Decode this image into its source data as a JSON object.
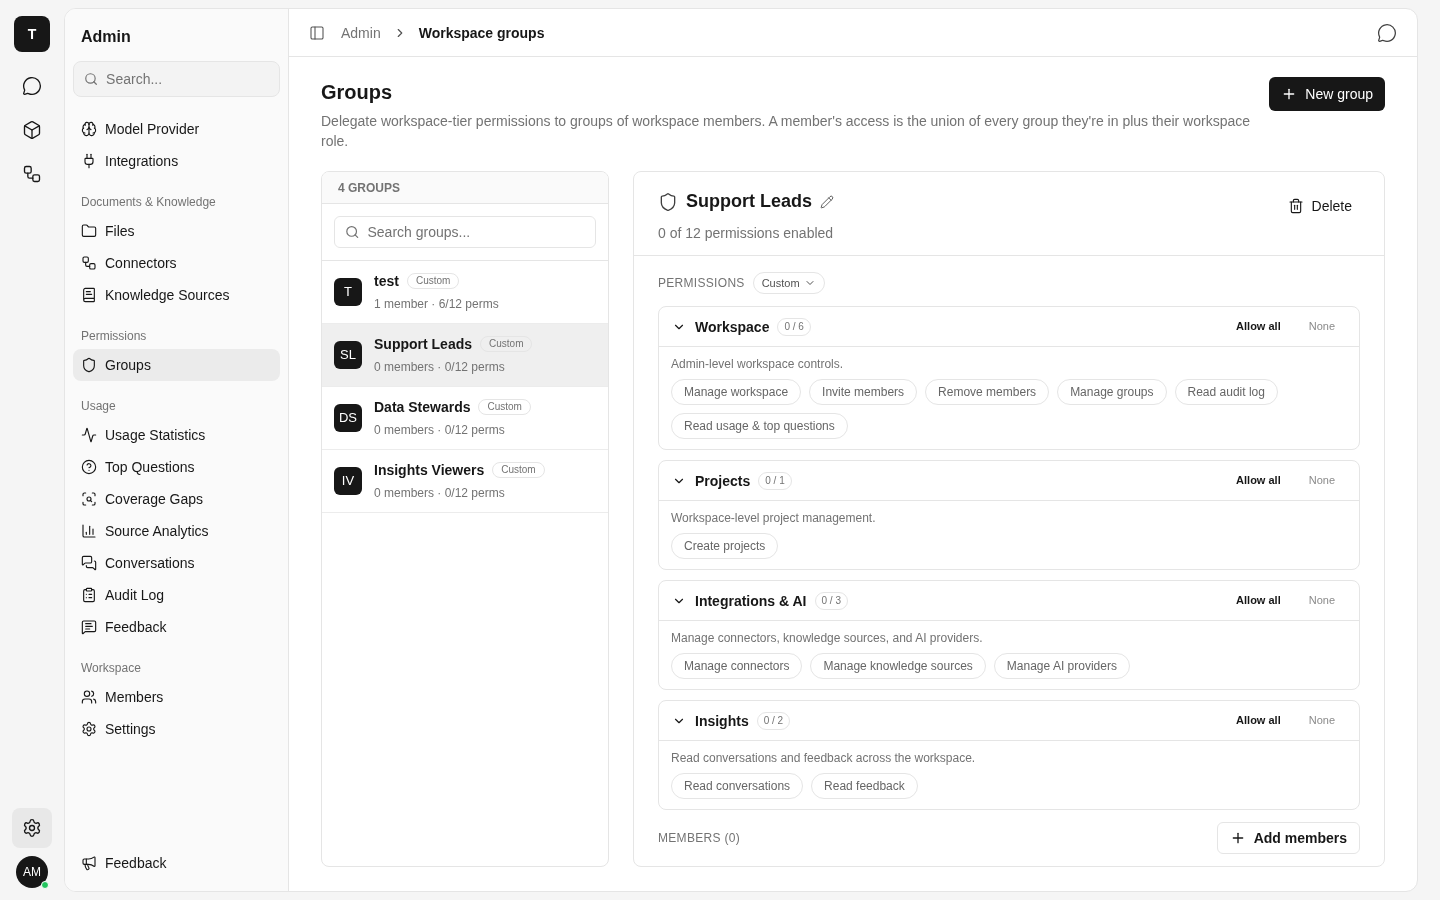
{
  "rail": {
    "logo": "T",
    "avatar": "AM",
    "online": true,
    "settings_selected": true
  },
  "sidebar": {
    "title": "Admin",
    "search_placeholder": "Search...",
    "sections": [
      {
        "items": [
          {
            "label": "Model Provider",
            "selected": false
          },
          {
            "label": "Integrations",
            "selected": false
          }
        ]
      },
      {
        "heading": "Documents & Knowledge",
        "items": [
          {
            "label": "Files",
            "selected": false
          },
          {
            "label": "Connectors",
            "selected": false
          },
          {
            "label": "Knowledge Sources",
            "selected": false
          }
        ]
      },
      {
        "heading": "Permissions",
        "items": [
          {
            "label": "Groups",
            "selected": true
          }
        ]
      },
      {
        "heading": "Usage",
        "items": [
          {
            "label": "Usage Statistics",
            "selected": false
          },
          {
            "label": "Top Questions",
            "selected": false
          },
          {
            "label": "Coverage Gaps",
            "selected": false
          },
          {
            "label": "Source Analytics",
            "selected": false
          },
          {
            "label": "Conversations",
            "selected": false
          },
          {
            "label": "Audit Log",
            "selected": false
          },
          {
            "label": "Feedback",
            "selected": false
          }
        ]
      },
      {
        "heading": "Workspace",
        "items": [
          {
            "label": "Members",
            "selected": false
          },
          {
            "label": "Settings",
            "selected": false
          }
        ]
      }
    ],
    "footer": "Feedback"
  },
  "breadcrumb": [
    "Admin",
    "Workspace groups"
  ],
  "page": {
    "title": "Groups",
    "description": "Delegate workspace-tier permissions to groups of workspace members. A member's access is the union of every group they're in plus their workspace role.",
    "new_button": "New group"
  },
  "groups_panel": {
    "count": "4 GROUPS",
    "search_placeholder": "Search groups...",
    "groups": [
      {
        "initials": "T",
        "name": "test",
        "tag": "Custom",
        "meta": "1 member · 6/12 perms",
        "selected": false
      },
      {
        "initials": "SL",
        "name": "Support Leads",
        "tag": "Custom",
        "meta": "0 members · 0/12 perms",
        "selected": true
      },
      {
        "initials": "DS",
        "name": "Data Stewards",
        "tag": "Custom",
        "meta": "0 members · 0/12 perms",
        "selected": false
      },
      {
        "initials": "IV",
        "name": "Insights Viewers",
        "tag": "Custom",
        "meta": "0 members · 0/12 perms",
        "selected": false
      }
    ]
  },
  "detail": {
    "name": "Support Leads",
    "summary": "0 of 12 permissions enabled",
    "delete": "Delete",
    "permissions_label": "PERMISSIONS",
    "preset": "Custom",
    "categories": [
      {
        "name": "Workspace",
        "count": "0 / 6",
        "expanded": true,
        "allow": "Allow all",
        "none": "None",
        "description": "Admin-level workspace controls.",
        "permissions": [
          "Manage workspace",
          "Invite members",
          "Remove members",
          "Manage groups",
          "Read audit log",
          "Read usage & top questions"
        ]
      },
      {
        "name": "Projects",
        "count": "0 / 1",
        "expanded": true,
        "allow": "Allow all",
        "none": "None",
        "description": "Workspace-level project management.",
        "permissions": [
          "Create projects"
        ]
      },
      {
        "name": "Integrations & AI",
        "count": "0 / 3",
        "expanded": true,
        "allow": "Allow all",
        "none": "None",
        "description": "Manage connectors, knowledge sources, and AI providers.",
        "permissions": [
          "Manage connectors",
          "Manage knowledge sources",
          "Manage AI providers"
        ]
      },
      {
        "name": "Insights",
        "count": "0 / 2",
        "expanded": true,
        "allow": "Allow all",
        "none": "None",
        "description": "Read conversations and feedback across the workspace.",
        "permissions": [
          "Read conversations",
          "Read feedback"
        ]
      }
    ],
    "members_label": "MEMBERS (0)",
    "add_members": "Add members"
  }
}
